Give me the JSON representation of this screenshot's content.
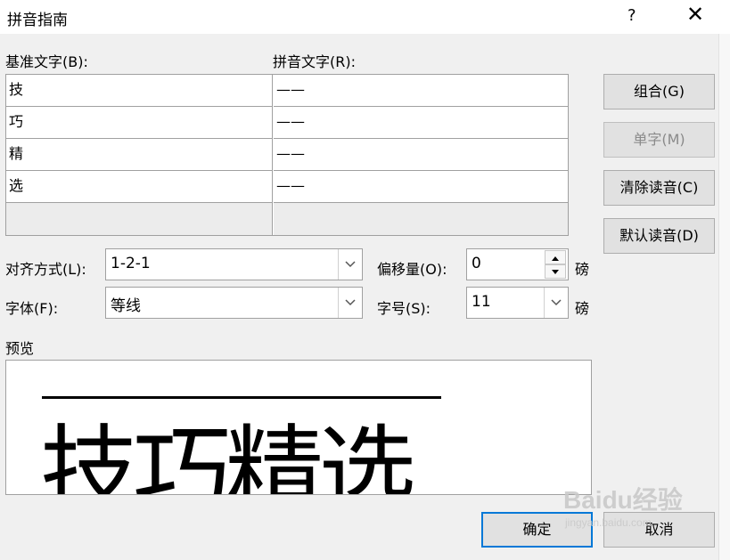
{
  "window": {
    "title": "拼音指南",
    "help_label": "?",
    "close_label": "✕"
  },
  "columns": {
    "base_label": "基准文字(B):",
    "ruby_label": "拼音文字(R):"
  },
  "rows": [
    {
      "base": "技",
      "ruby": "——"
    },
    {
      "base": "巧",
      "ruby": "——"
    },
    {
      "base": "精",
      "ruby": "——"
    },
    {
      "base": "选",
      "ruby": "——"
    }
  ],
  "buttons": {
    "group": "组合(G)",
    "mono": "单字(M)",
    "clear": "清除读音(C)",
    "default": "默认读音(D)",
    "ok": "确定",
    "cancel": "取消"
  },
  "alignment": {
    "label": "对齐方式(L):",
    "value": "1-2-1"
  },
  "offset": {
    "label": "偏移量(O):",
    "value": "0",
    "unit": "磅"
  },
  "font": {
    "label": "字体(F):",
    "value": "等线"
  },
  "size": {
    "label": "字号(S):",
    "value": "11",
    "unit": "磅"
  },
  "preview": {
    "label": "预览",
    "text": "技巧精选"
  },
  "watermark": {
    "brand": "Baidu经验",
    "url": "jingyan.baidu.com"
  },
  "icons": {
    "close": "close-icon",
    "dropdown": "chevron-down-icon",
    "spin_up": "triangle-up-icon",
    "spin_down": "triangle-down-icon"
  }
}
